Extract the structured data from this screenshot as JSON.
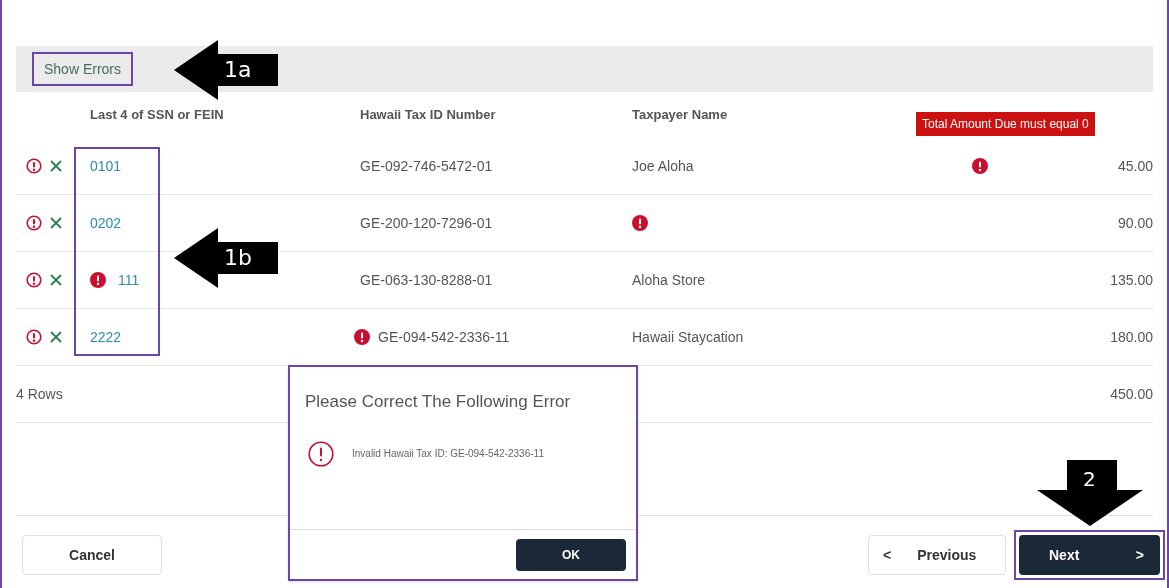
{
  "toolbar": {
    "show_errors_button": "Show Errors"
  },
  "table": {
    "columns": [
      "Last 4 of SSN or FEIN",
      "Hawaii Tax ID Number",
      "Taxpayer Name"
    ],
    "tooltip": "Total Amount Due must equal 0",
    "rows": [
      {
        "ssn": "0101",
        "tax_id": "GE-092-746-5472-01",
        "name": "Joe Aloha",
        "amount": "45.00",
        "ssn_error": false,
        "tax_id_error": false,
        "name_error": false,
        "amount_error": true
      },
      {
        "ssn": "0202",
        "tax_id": "GE-200-120-7296-01",
        "name": "",
        "amount": "90.00",
        "ssn_error": false,
        "tax_id_error": false,
        "name_error": true,
        "amount_error": false
      },
      {
        "ssn": "111",
        "tax_id": "GE-063-130-8288-01",
        "name": "Aloha Store",
        "amount": "135.00",
        "ssn_error": true,
        "tax_id_error": false,
        "name_error": false,
        "amount_error": false
      },
      {
        "ssn": "2222",
        "tax_id": "GE-094-542-2336-11",
        "name": "Hawaii Staycation",
        "amount": "180.00",
        "ssn_error": false,
        "tax_id_error": true,
        "name_error": false,
        "amount_error": false
      }
    ],
    "footer": {
      "row_count": "4 Rows",
      "total": "450.00"
    }
  },
  "dialog": {
    "title": "Please Correct The Following Error",
    "message": "Invalid Hawaii Tax ID: GE-094-542-2336-11",
    "button": "OK"
  },
  "buttons": {
    "cancel": "Cancel",
    "previous_icon": "<",
    "previous": "Previous",
    "next": "Next",
    "next_icon": ">"
  },
  "annotations": [
    {
      "label": "1a",
      "kind": "left"
    },
    {
      "label": "1b",
      "kind": "left"
    },
    {
      "label": "2",
      "kind": "down"
    }
  ]
}
